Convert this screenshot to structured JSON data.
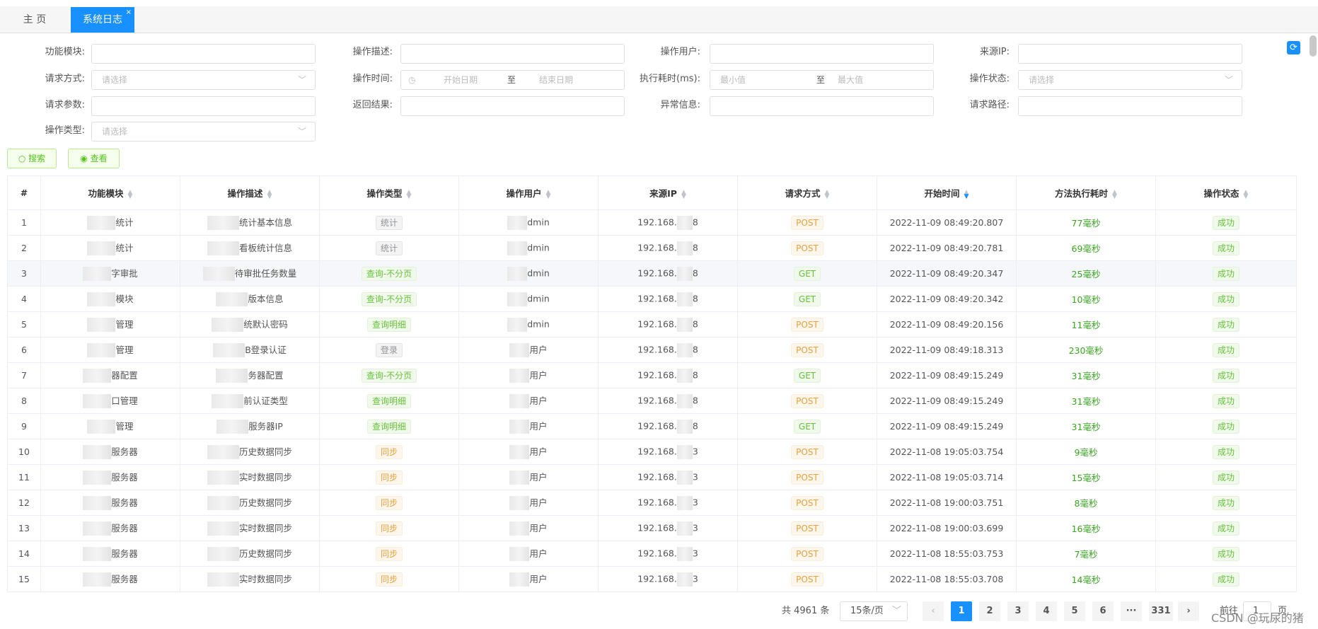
{
  "tabs": {
    "home": "主 页",
    "active": "系统日志",
    "close": "×"
  },
  "filters": {
    "module_label": "功能模块:",
    "desc_label": "操作描述:",
    "user_label": "操作用户:",
    "ip_label": "来源IP:",
    "method_label": "请求方式:",
    "method_placeholder": "请选择",
    "time_label": "操作时间:",
    "start_placeholder": "开始日期",
    "range_sep": "至",
    "end_placeholder": "结束日期",
    "cost_label": "执行耗时(ms):",
    "min_placeholder": "最小值",
    "max_placeholder": "最大值",
    "status_label": "操作状态:",
    "status_placeholder": "请选择",
    "params_label": "请求参数:",
    "result_label": "返回结果:",
    "error_label": "异常信息:",
    "path_label": "请求路径:",
    "type_label": "操作类型:",
    "type_placeholder": "请选择"
  },
  "buttons": {
    "search": "搜索",
    "view": "查看"
  },
  "table": {
    "headers": [
      "#",
      "功能模块",
      "操作描述",
      "操作类型",
      "操作用户",
      "来源IP",
      "请求方式",
      "开始时间",
      "方法执行耗时",
      "操作状态"
    ],
    "rows": [
      {
        "no": "1",
        "module": "统计",
        "desc": "统计基本信息",
        "type": "统计",
        "type_color": "grey",
        "user": "dmin",
        "ip": "192.168.",
        "ip_end": "8",
        "method": "POST",
        "start": "2022-11-09 08:49:20.807",
        "cost": "77毫秒",
        "status": "成功"
      },
      {
        "no": "2",
        "module": "统计",
        "desc": "看板统计信息",
        "type": "统计",
        "type_color": "grey",
        "user": "dmin",
        "ip": "192.168.",
        "ip_end": "8",
        "method": "POST",
        "start": "2022-11-09 08:49:20.781",
        "cost": "69毫秒",
        "status": "成功"
      },
      {
        "no": "3",
        "module": "字审批",
        "desc": "待审批任务数量",
        "type": "查询-不分页",
        "type_color": "green",
        "user": "dmin",
        "ip": "192.168.",
        "ip_end": "8",
        "method": "GET",
        "start": "2022-11-09 08:49:20.347",
        "cost": "25毫秒",
        "status": "成功"
      },
      {
        "no": "4",
        "module": "模块",
        "desc": "版本信息",
        "type": "查询-不分页",
        "type_color": "green",
        "user": "dmin",
        "ip": "192.168.",
        "ip_end": "8",
        "method": "GET",
        "start": "2022-11-09 08:49:20.342",
        "cost": "10毫秒",
        "status": "成功"
      },
      {
        "no": "5",
        "module": "管理",
        "desc": "统默认密码",
        "type": "查询明细",
        "type_color": "green",
        "user": "dmin",
        "ip": "192.168.",
        "ip_end": "8",
        "method": "POST",
        "start": "2022-11-09 08:49:20.156",
        "cost": "11毫秒",
        "status": "成功"
      },
      {
        "no": "6",
        "module": "管理",
        "desc": "B登录认证",
        "type": "登录",
        "type_color": "grey",
        "user": "用户",
        "ip": "192.168.",
        "ip_end": "8",
        "method": "POST",
        "start": "2022-11-09 08:49:18.313",
        "cost": "230毫秒",
        "status": "成功"
      },
      {
        "no": "7",
        "module": "器配置",
        "desc": "务器配置",
        "type": "查询-不分页",
        "type_color": "green",
        "user": "用户",
        "ip": "192.168.",
        "ip_end": "8",
        "method": "GET",
        "start": "2022-11-09 08:49:15.249",
        "cost": "31毫秒",
        "status": "成功"
      },
      {
        "no": "8",
        "module": "口管理",
        "desc": "前认证类型",
        "type": "查询明细",
        "type_color": "green",
        "user": "用户",
        "ip": "192.168.",
        "ip_end": "8",
        "method": "POST",
        "start": "2022-11-09 08:49:15.249",
        "cost": "31毫秒",
        "status": "成功"
      },
      {
        "no": "9",
        "module": "管理",
        "desc": "服务器IP",
        "type": "查询明细",
        "type_color": "green",
        "user": "用户",
        "ip": "192.168.",
        "ip_end": "8",
        "method": "GET",
        "start": "2022-11-09 08:49:15.249",
        "cost": "31毫秒",
        "status": "成功"
      },
      {
        "no": "10",
        "module": "服务器",
        "desc": "历史数据同步",
        "type": "同步",
        "type_color": "orange",
        "user": "用户",
        "ip": "192.168.",
        "ip_end": "3",
        "method": "POST",
        "start": "2022-11-08 19:05:03.754",
        "cost": "9毫秒",
        "status": "成功"
      },
      {
        "no": "11",
        "module": "服务器",
        "desc": "实时数据同步",
        "type": "同步",
        "type_color": "orange",
        "user": "用户",
        "ip": "192.168.",
        "ip_end": "3",
        "method": "POST",
        "start": "2022-11-08 19:05:03.714",
        "cost": "15毫秒",
        "status": "成功"
      },
      {
        "no": "12",
        "module": "服务器",
        "desc": "历史数据同步",
        "type": "同步",
        "type_color": "orange",
        "user": "用户",
        "ip": "192.168.",
        "ip_end": "3",
        "method": "POST",
        "start": "2022-11-08 19:00:03.751",
        "cost": "8毫秒",
        "status": "成功"
      },
      {
        "no": "13",
        "module": "服务器",
        "desc": "实时数据同步",
        "type": "同步",
        "type_color": "orange",
        "user": "用户",
        "ip": "192.168.",
        "ip_end": "3",
        "method": "POST",
        "start": "2022-11-08 19:00:03.699",
        "cost": "16毫秒",
        "status": "成功"
      },
      {
        "no": "14",
        "module": "服务器",
        "desc": "历史数据同步",
        "type": "同步",
        "type_color": "orange",
        "user": "用户",
        "ip": "192.168.",
        "ip_end": "3",
        "method": "POST",
        "start": "2022-11-08 18:55:03.753",
        "cost": "7毫秒",
        "status": "成功"
      },
      {
        "no": "15",
        "module": "服务器",
        "desc": "实时数据同步",
        "type": "同步",
        "type_color": "orange",
        "user": "用户",
        "ip": "192.168.",
        "ip_end": "3",
        "method": "POST",
        "start": "2022-11-08 18:55:03.708",
        "cost": "14毫秒",
        "status": "成功"
      }
    ]
  },
  "pagination": {
    "total": "共 4961 条",
    "page_size": "15条/页",
    "pages": [
      "1",
      "2",
      "3",
      "4",
      "5",
      "6",
      "···",
      "331"
    ],
    "current": "1",
    "goto_label": "前往",
    "goto_value": "1",
    "goto_suffix": "页"
  },
  "watermark": "CSDN @玩尿的猪",
  "colors": {
    "primary": "#1890ff",
    "success": "#67c23a",
    "warning": "#e6a23c"
  }
}
